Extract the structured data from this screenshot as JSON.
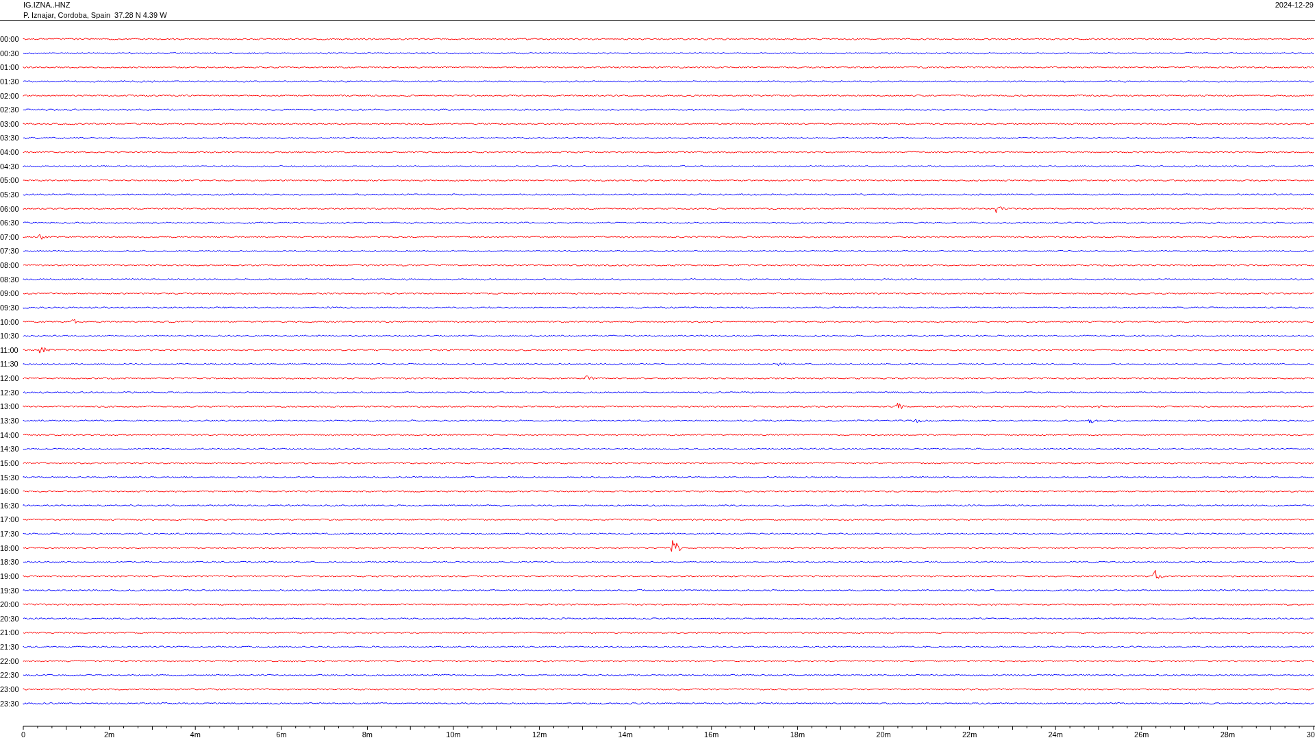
{
  "header": {
    "station": "IG.IZNA..HNZ",
    "location": "P. Iznajar, Cordoba, Spain  37.28 N 4.39 W",
    "date": "2024-12-29"
  },
  "traces": [
    {
      "time": "00:00",
      "color": "#ff0000"
    },
    {
      "time": "00:30",
      "color": "#0000ff"
    },
    {
      "time": "01:00",
      "color": "#ff0000"
    },
    {
      "time": "01:30",
      "color": "#0000ff"
    },
    {
      "time": "02:00",
      "color": "#ff0000"
    },
    {
      "time": "02:30",
      "color": "#0000ff"
    },
    {
      "time": "03:00",
      "color": "#ff0000"
    },
    {
      "time": "03:30",
      "color": "#0000ff"
    },
    {
      "time": "04:00",
      "color": "#ff0000"
    },
    {
      "time": "04:30",
      "color": "#0000ff"
    },
    {
      "time": "05:00",
      "color": "#ff0000"
    },
    {
      "time": "05:30",
      "color": "#0000ff"
    },
    {
      "time": "06:00",
      "color": "#ff0000"
    },
    {
      "time": "06:30",
      "color": "#0000ff"
    },
    {
      "time": "07:00",
      "color": "#ff0000"
    },
    {
      "time": "07:30",
      "color": "#0000ff"
    },
    {
      "time": "08:00",
      "color": "#ff0000"
    },
    {
      "time": "08:30",
      "color": "#0000ff"
    },
    {
      "time": "09:00",
      "color": "#ff0000"
    },
    {
      "time": "09:30",
      "color": "#0000ff"
    },
    {
      "time": "10:00",
      "color": "#ff0000"
    },
    {
      "time": "10:30",
      "color": "#0000ff"
    },
    {
      "time": "11:00",
      "color": "#ff0000"
    },
    {
      "time": "11:30",
      "color": "#0000ff"
    },
    {
      "time": "12:00",
      "color": "#ff0000"
    },
    {
      "time": "12:30",
      "color": "#0000ff"
    },
    {
      "time": "13:00",
      "color": "#ff0000"
    },
    {
      "time": "13:30",
      "color": "#0000ff"
    },
    {
      "time": "14:00",
      "color": "#ff0000"
    },
    {
      "time": "14:30",
      "color": "#0000ff"
    },
    {
      "time": "15:00",
      "color": "#ff0000"
    },
    {
      "time": "15:30",
      "color": "#0000ff"
    },
    {
      "time": "16:00",
      "color": "#ff0000"
    },
    {
      "time": "16:30",
      "color": "#0000ff"
    },
    {
      "time": "17:00",
      "color": "#ff0000"
    },
    {
      "time": "17:30",
      "color": "#0000ff"
    },
    {
      "time": "18:00",
      "color": "#ff0000"
    },
    {
      "time": "18:30",
      "color": "#0000ff"
    },
    {
      "time": "19:00",
      "color": "#ff0000"
    },
    {
      "time": "19:30",
      "color": "#0000ff"
    },
    {
      "time": "20:00",
      "color": "#ff0000"
    },
    {
      "time": "20:30",
      "color": "#0000ff"
    },
    {
      "time": "21:00",
      "color": "#ff0000"
    },
    {
      "time": "21:30",
      "color": "#0000ff"
    },
    {
      "time": "22:00",
      "color": "#ff0000"
    },
    {
      "time": "22:30",
      "color": "#0000ff"
    },
    {
      "time": "23:00",
      "color": "#ff0000"
    },
    {
      "time": "23:30",
      "color": "#0000ff"
    }
  ],
  "x_axis": {
    "ticks": [
      "0",
      "2m",
      "4m",
      "6m",
      "8m",
      "10m",
      "12m",
      "14m",
      "16m",
      "18m",
      "20m",
      "22m",
      "24m",
      "26m",
      "28m",
      "30"
    ]
  }
}
